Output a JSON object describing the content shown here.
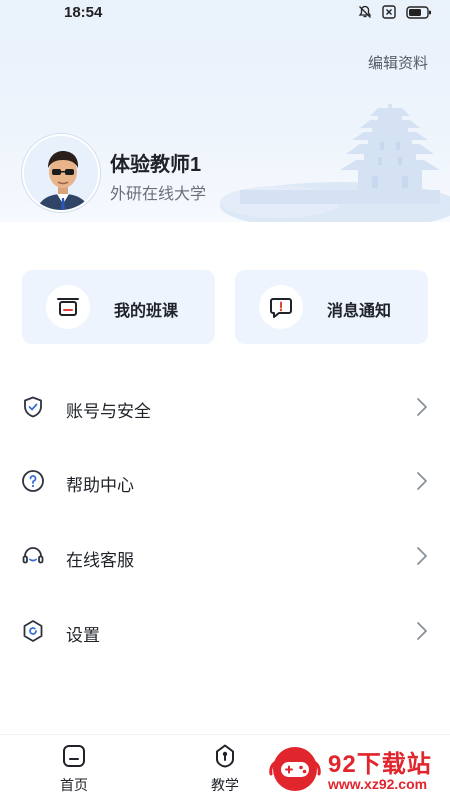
{
  "status_bar": {
    "time": "18:54",
    "icons": [
      "bell-off-icon",
      "close-box-icon",
      "battery-icon"
    ]
  },
  "profile": {
    "edit_label": "编辑资料",
    "name": "体验教师1",
    "school": "外研在线大学"
  },
  "cards": [
    {
      "label": "我的班课",
      "icon": "class-icon"
    },
    {
      "label": "消息通知",
      "icon": "message-icon"
    }
  ],
  "menu": [
    {
      "label": "账号与安全",
      "icon": "shield-icon"
    },
    {
      "label": "帮助中心",
      "icon": "help-icon"
    },
    {
      "label": "在线客服",
      "icon": "headset-icon"
    },
    {
      "label": "设置",
      "icon": "settings-icon"
    }
  ],
  "tabbar": [
    {
      "label": "首页",
      "icon": "home-icon"
    },
    {
      "label": "教学",
      "icon": "teach-icon"
    }
  ],
  "watermark": {
    "title": "92下载站",
    "url": "www.xz92.com"
  },
  "colors": {
    "header_bg": "#eef4fc",
    "card_bg": "#eef4fd",
    "accent_blue": "#3a6fd8",
    "watermark_red": "#e0252c"
  }
}
